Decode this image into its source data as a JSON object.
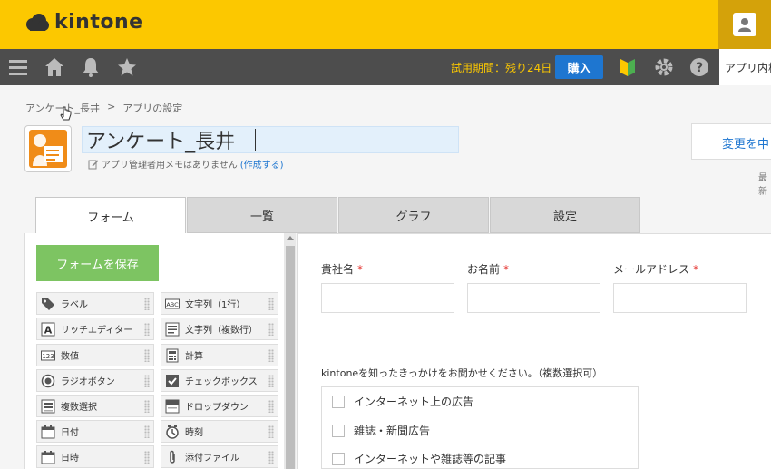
{
  "brand": {
    "name": "kintone"
  },
  "header": {
    "trial_text": "試用期間：残り24日",
    "buy_label": "購入",
    "app_menu_label": "アプリ内検"
  },
  "breadcrumb": {
    "items": [
      "アンケート_長井",
      ">",
      "アプリの設定"
    ]
  },
  "app": {
    "title": "アンケート_長井",
    "memo_text": "アプリ管理者用メモはありません",
    "memo_link": "(作成する)",
    "apply_label": "変更を中",
    "latest_label": "最新"
  },
  "tabs": [
    {
      "label": "フォーム",
      "active": true
    },
    {
      "label": "一覧",
      "active": false
    },
    {
      "label": "グラフ",
      "active": false
    },
    {
      "label": "設定",
      "active": false
    }
  ],
  "sidebar": {
    "save_label": "フォームを保存",
    "items": [
      {
        "label": "ラベル",
        "icon": "tag-icon"
      },
      {
        "label": "文字列（1行）",
        "icon": "abc-icon"
      },
      {
        "label": "リッチエディター",
        "icon": "rich-editor-icon"
      },
      {
        "label": "文字列（複数行）",
        "icon": "multiline-icon"
      },
      {
        "label": "数値",
        "icon": "number-icon"
      },
      {
        "label": "計算",
        "icon": "calculator-icon"
      },
      {
        "label": "ラジオボタン",
        "icon": "radio-icon"
      },
      {
        "label": "チェックボックス",
        "icon": "checkbox-icon"
      },
      {
        "label": "複数選択",
        "icon": "multi-select-icon"
      },
      {
        "label": "ドロップダウン",
        "icon": "dropdown-icon"
      },
      {
        "label": "日付",
        "icon": "calendar-icon"
      },
      {
        "label": "時刻",
        "icon": "clock-icon"
      },
      {
        "label": "日時",
        "icon": "datetime-icon"
      },
      {
        "label": "添付ファイル",
        "icon": "paperclip-icon"
      }
    ]
  },
  "form": {
    "fields": [
      {
        "label": "貴社名",
        "required": "*"
      },
      {
        "label": "お名前",
        "required": "*"
      },
      {
        "label": "メールアドレス",
        "required": "*"
      }
    ],
    "question": "kintoneを知ったきっかけをお聞かせください。（複数選択可）",
    "options": [
      "インターネット上の広告",
      "雑誌・新聞広告",
      "インターネットや雑誌等の記事"
    ]
  },
  "colors": {
    "brand_yellow": "#fcc800",
    "header_dark": "#4d4d4d",
    "accent_blue": "#1e76d0",
    "save_green": "#7dc462"
  }
}
